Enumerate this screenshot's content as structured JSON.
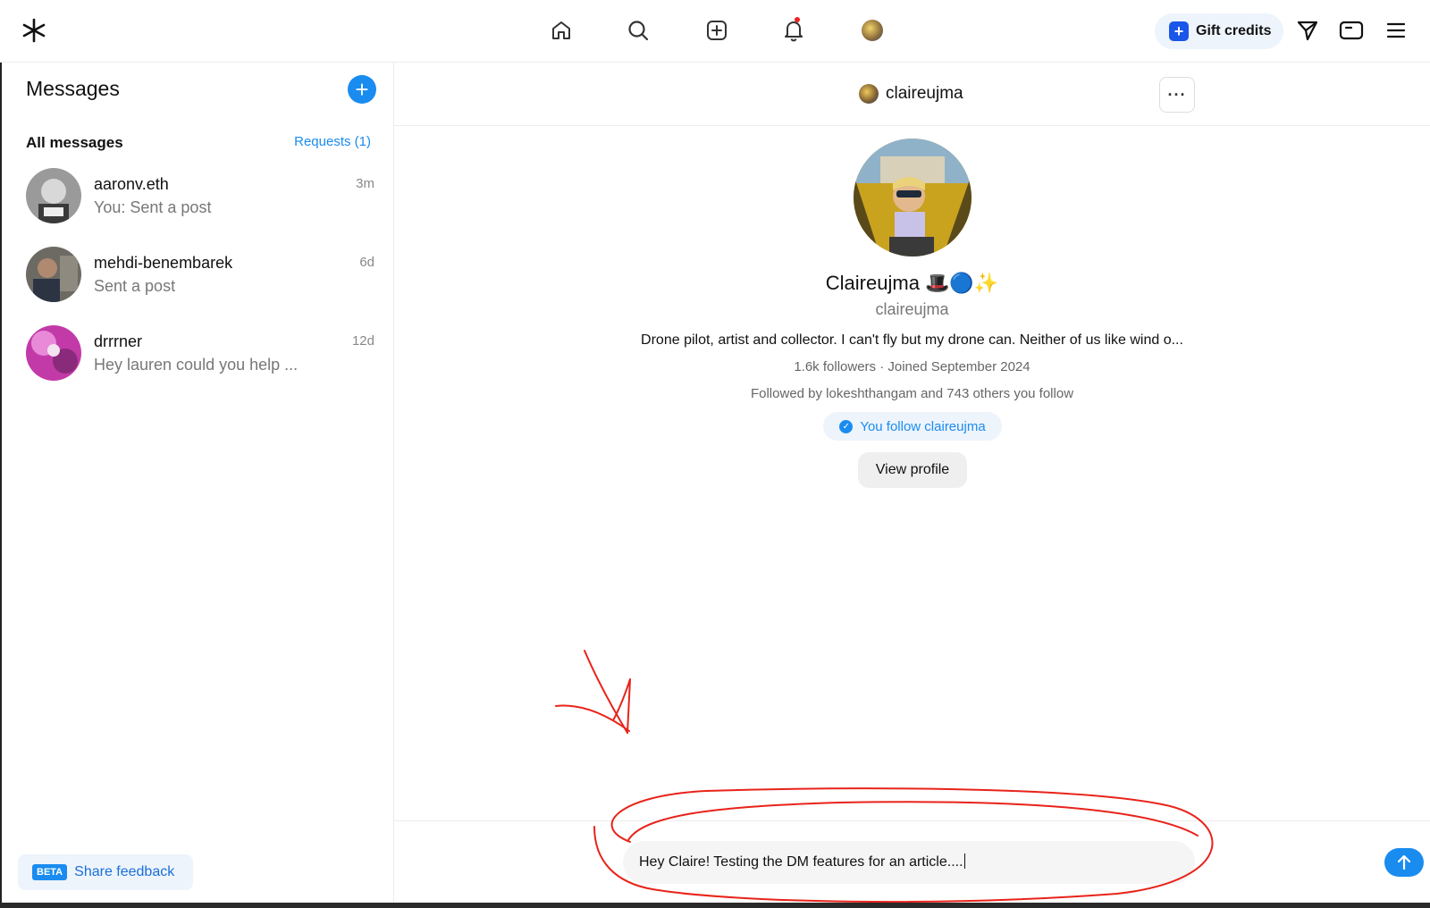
{
  "topbar": {
    "logo_icon": "asterisk-logo-icon",
    "nav": [
      "home-icon",
      "search-icon",
      "create-post-icon",
      "notifications-icon",
      "profile-avatar"
    ],
    "gift_label": "Gift credits",
    "right_icons": [
      "send-icon",
      "wallet-icon",
      "menu-icon"
    ]
  },
  "sidebar": {
    "title": "Messages",
    "section_label": "All messages",
    "requests_label": "Requests (1)",
    "conversations": [
      {
        "name": "aaronv.eth",
        "preview": "You: Sent a post",
        "time": "3m"
      },
      {
        "name": "mehdi-benembarek",
        "preview": "Sent a post",
        "time": "6d"
      },
      {
        "name": "drrrner",
        "preview": "Hey lauren could you help ...",
        "time": "12d"
      }
    ],
    "beta_label": "BETA",
    "feedback_label": "Share feedback"
  },
  "chat": {
    "header_name": "claireujma",
    "more_label": "···",
    "profile": {
      "display_name": "Claireujma 🎩🔵✨",
      "handle": "claireujma",
      "bio": "Drone pilot, artist and collector. I can't fly but my drone can. Neither of us like wind o...",
      "stats": "1.6k followers · Joined September 2024",
      "followed_by": "Followed by lokeshthangam and 743 others you follow",
      "follow_status": "You follow claireujma",
      "view_profile_label": "View profile"
    },
    "composer_value": "Hey Claire! Testing the DM features for an article....",
    "send_icon": "arrow-up-icon"
  },
  "colors": {
    "accent": "#1a8cf0",
    "annotation": "#e8231a"
  }
}
